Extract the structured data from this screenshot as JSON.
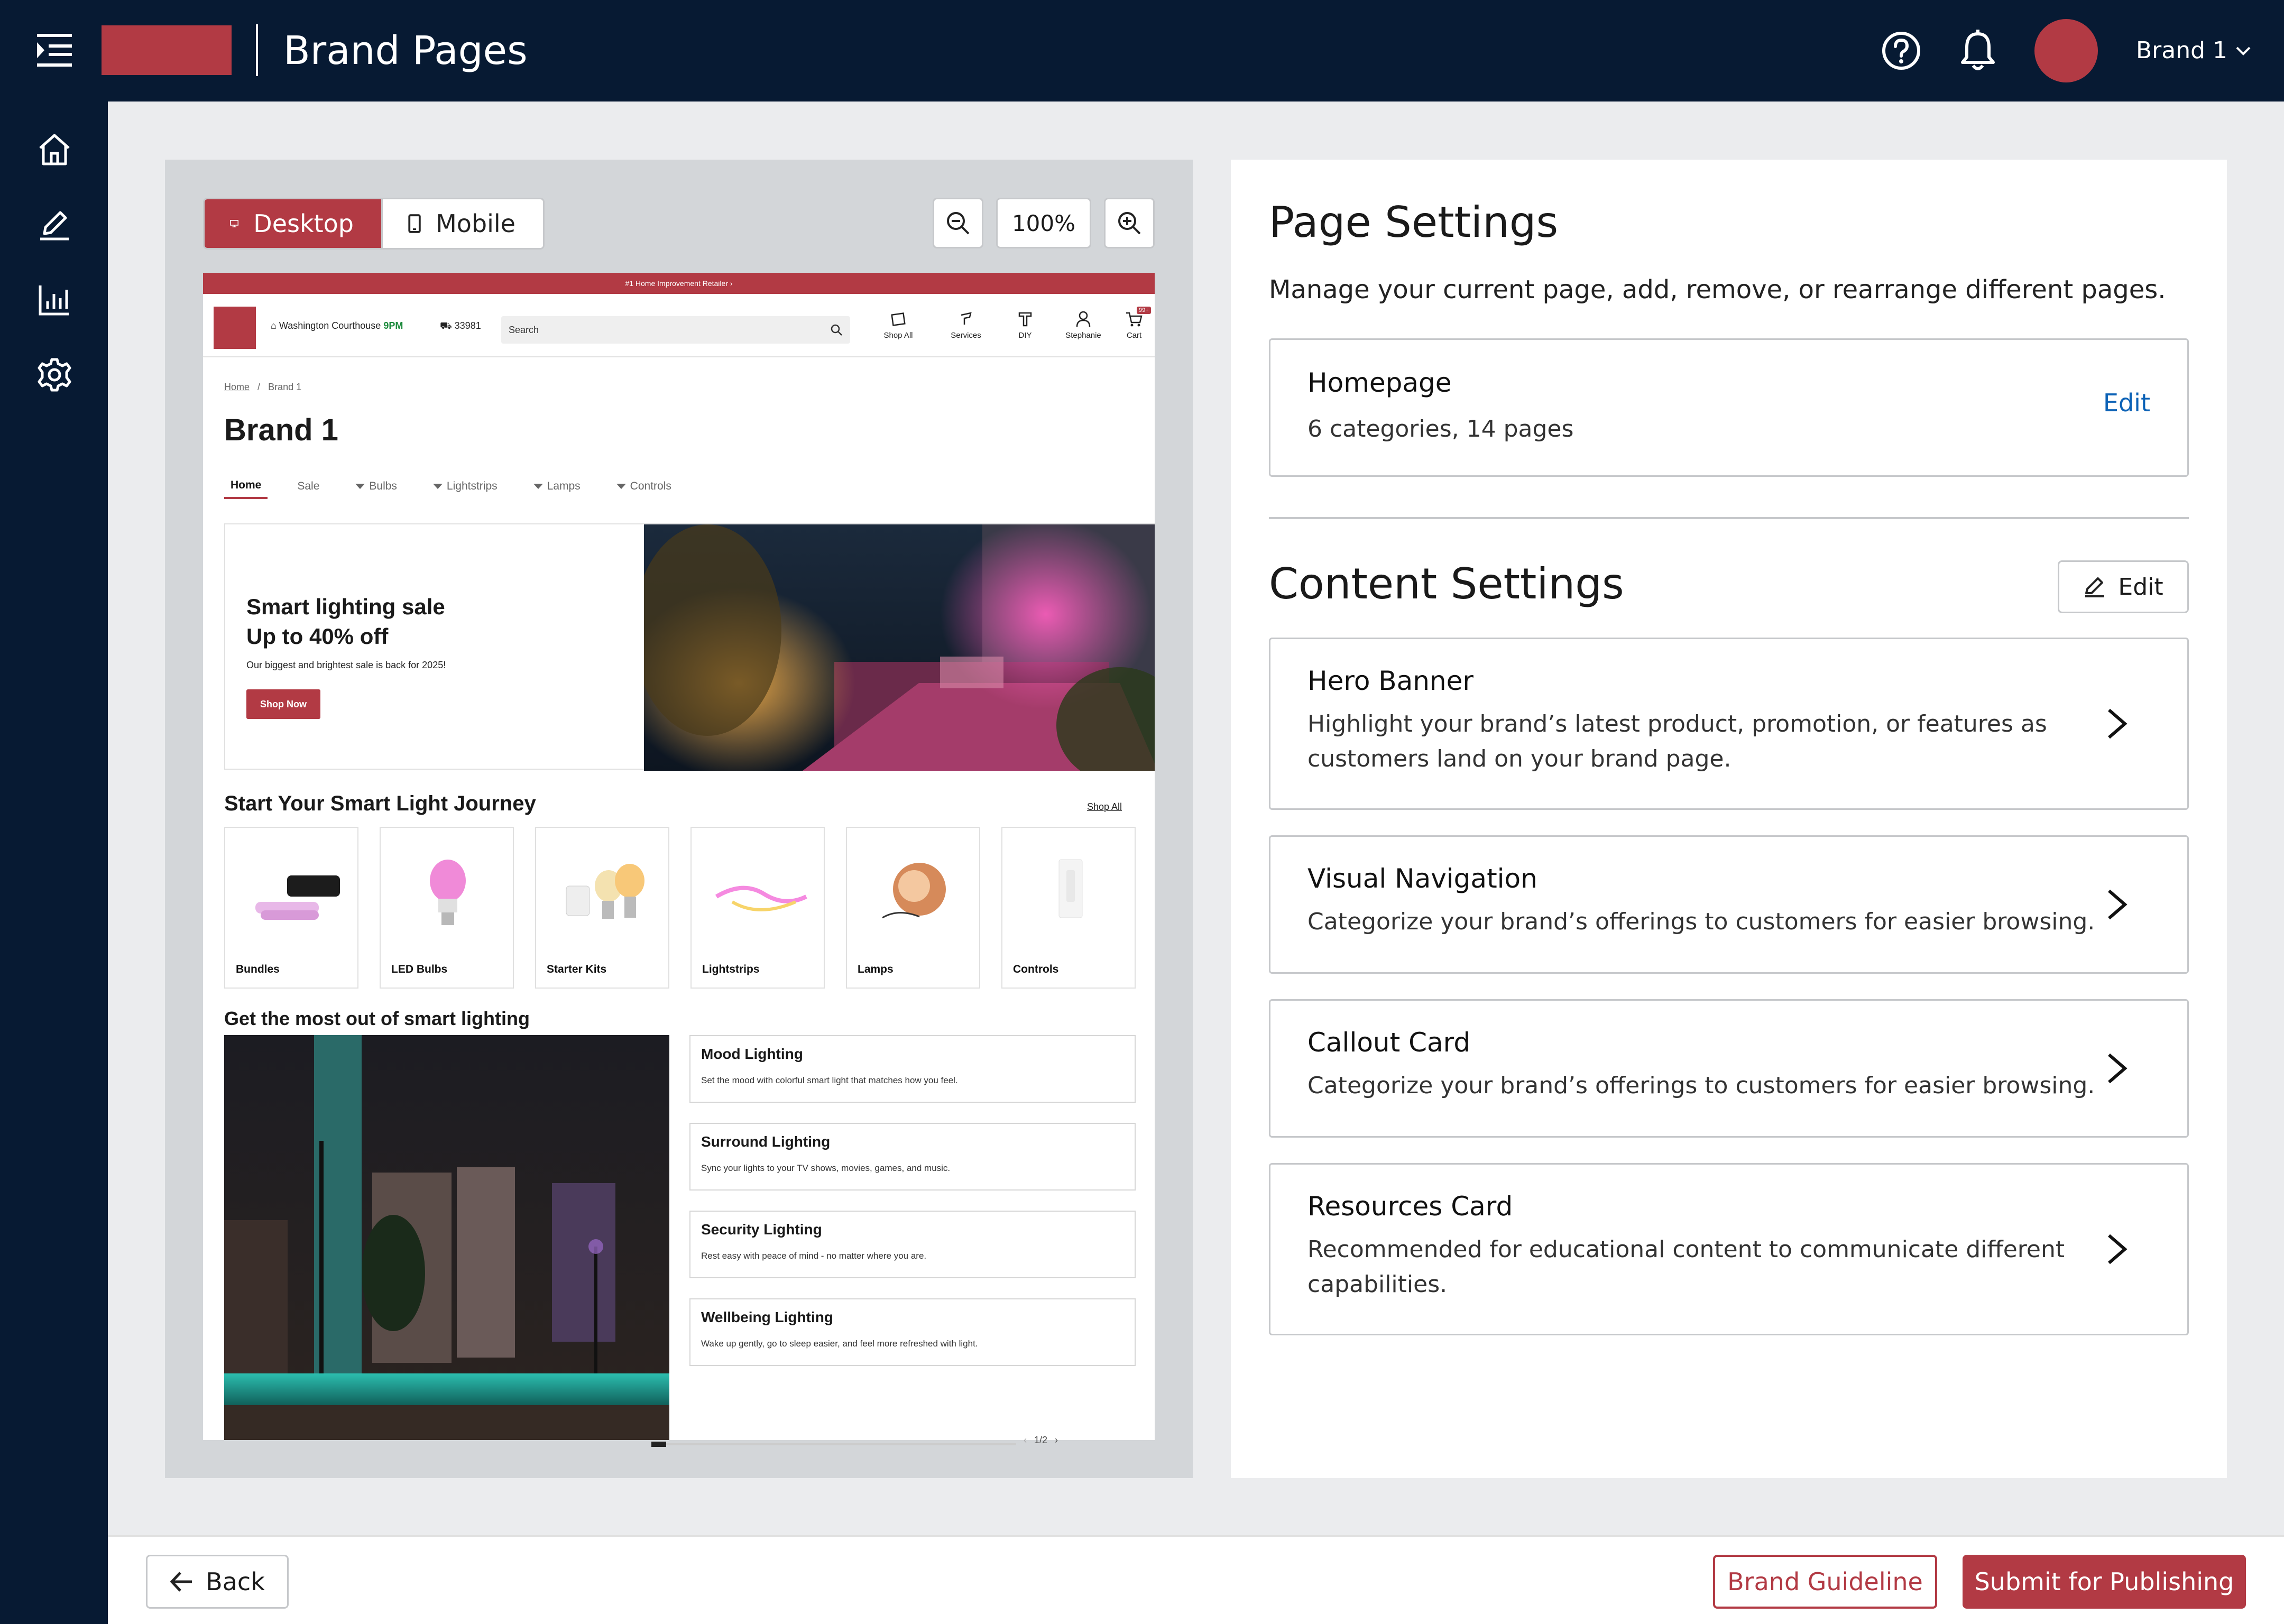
{
  "header": {
    "title": "Brand Pages",
    "brand_selector": "Brand 1",
    "icons": [
      "menu-icon",
      "help-icon",
      "bell-icon"
    ],
    "accent_color": "#b23a44",
    "bg_color": "#071a33"
  },
  "sidenav": {
    "items": [
      "home-icon",
      "edit-icon",
      "analytics-icon",
      "settings-icon"
    ]
  },
  "preview": {
    "view_desktop": "Desktop",
    "view_mobile": "Mobile",
    "zoom": "100%",
    "store": {
      "promo": "#1 Home Improvement Retailer",
      "location": "Washington Courthouse",
      "hours": "9PM",
      "zip": "33981",
      "search_placeholder": "Search",
      "nav": [
        "Shop All",
        "Services",
        "DIY",
        "Stephanie",
        "Cart"
      ],
      "cart_badge": "99+",
      "breadcrumb_home": "Home",
      "breadcrumb_sep": "/",
      "breadcrumb_current": "Brand 1",
      "title": "Brand 1",
      "tabs": [
        "Home",
        "Sale",
        "Bulbs",
        "Lightstrips",
        "Lamps",
        "Controls"
      ],
      "hero": {
        "title": "Smart lighting sale Up to 40% off",
        "subtitle": "Our biggest and brightest sale is back for 2025!",
        "button": "Shop Now"
      },
      "journey": {
        "title": "Start Your Smart Light Journey",
        "shop_all": "Shop All",
        "categories": [
          "Bundles",
          "LED Bulbs",
          "Starter Kits",
          "Lightstrips",
          "Lamps",
          "Controls"
        ]
      },
      "most": {
        "title": "Get the most out of smart lighting",
        "cards": [
          {
            "title": "Mood Lighting",
            "desc": "Set the mood with colorful smart light that matches how you feel."
          },
          {
            "title": "Surround Lighting",
            "desc": "Sync your lights to your TV shows, movies, games, and music."
          },
          {
            "title": "Security Lighting",
            "desc": "Rest easy with peace of mind - no matter where you are."
          },
          {
            "title": "Wellbeing Lighting",
            "desc": "Wake up gently, go to sleep easier, and feel more refreshed with light."
          }
        ],
        "page": "1/2",
        "progress": 0.5
      }
    }
  },
  "settings": {
    "page_title": "Page Settings",
    "page_desc": "Manage your current page, add, remove, or rearrange different pages.",
    "homepage": {
      "title": "Homepage",
      "desc": "6 categories, 14 pages",
      "edit": "Edit"
    },
    "content_title": "Content Settings",
    "content_edit": "Edit",
    "items": [
      {
        "title": "Hero Banner",
        "desc": "Highlight your brand’s latest product, promotion, or features as customers land on your brand page."
      },
      {
        "title": "Visual Navigation",
        "desc": "Categorize your brand’s offerings to customers for easier browsing."
      },
      {
        "title": "Callout Card",
        "desc": "Categorize your brand’s offerings to customers for easier browsing."
      },
      {
        "title": "Resources Card",
        "desc": "Recommended for educational content to communicate different capabilities."
      }
    ]
  },
  "footer": {
    "back": "Back",
    "guideline": "Brand Guideline",
    "submit": "Submit for Publishing"
  }
}
